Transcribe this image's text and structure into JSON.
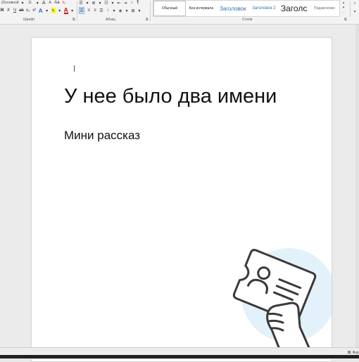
{
  "ribbon": {
    "font": {
      "name": "(Основной",
      "size": "11",
      "group_label": "Шрифт",
      "launcher": "⧉"
    },
    "paragraph": {
      "group_label": "Абзац",
      "launcher": "⧉"
    },
    "styles": {
      "group_label": "Стили",
      "launcher": "⧉",
      "items": [
        {
          "label": "Обычный"
        },
        {
          "label": "Без интервала"
        },
        {
          "label": "Заголовок"
        },
        {
          "label": "Заголовок 2"
        },
        {
          "label": "Заголс"
        },
        {
          "label": "Подзаголово"
        }
      ]
    }
  },
  "document": {
    "title": "У нее было два имени",
    "subtitle": "Мини рассказ"
  },
  "status": {
    "label": "Фор"
  },
  "colors": {
    "ribbon_bg": "#f3f3f3",
    "heading_blue": "#2e74b5",
    "illustration_circle": "#e3f1fb",
    "illustration_stroke": "#3a3a3a"
  }
}
